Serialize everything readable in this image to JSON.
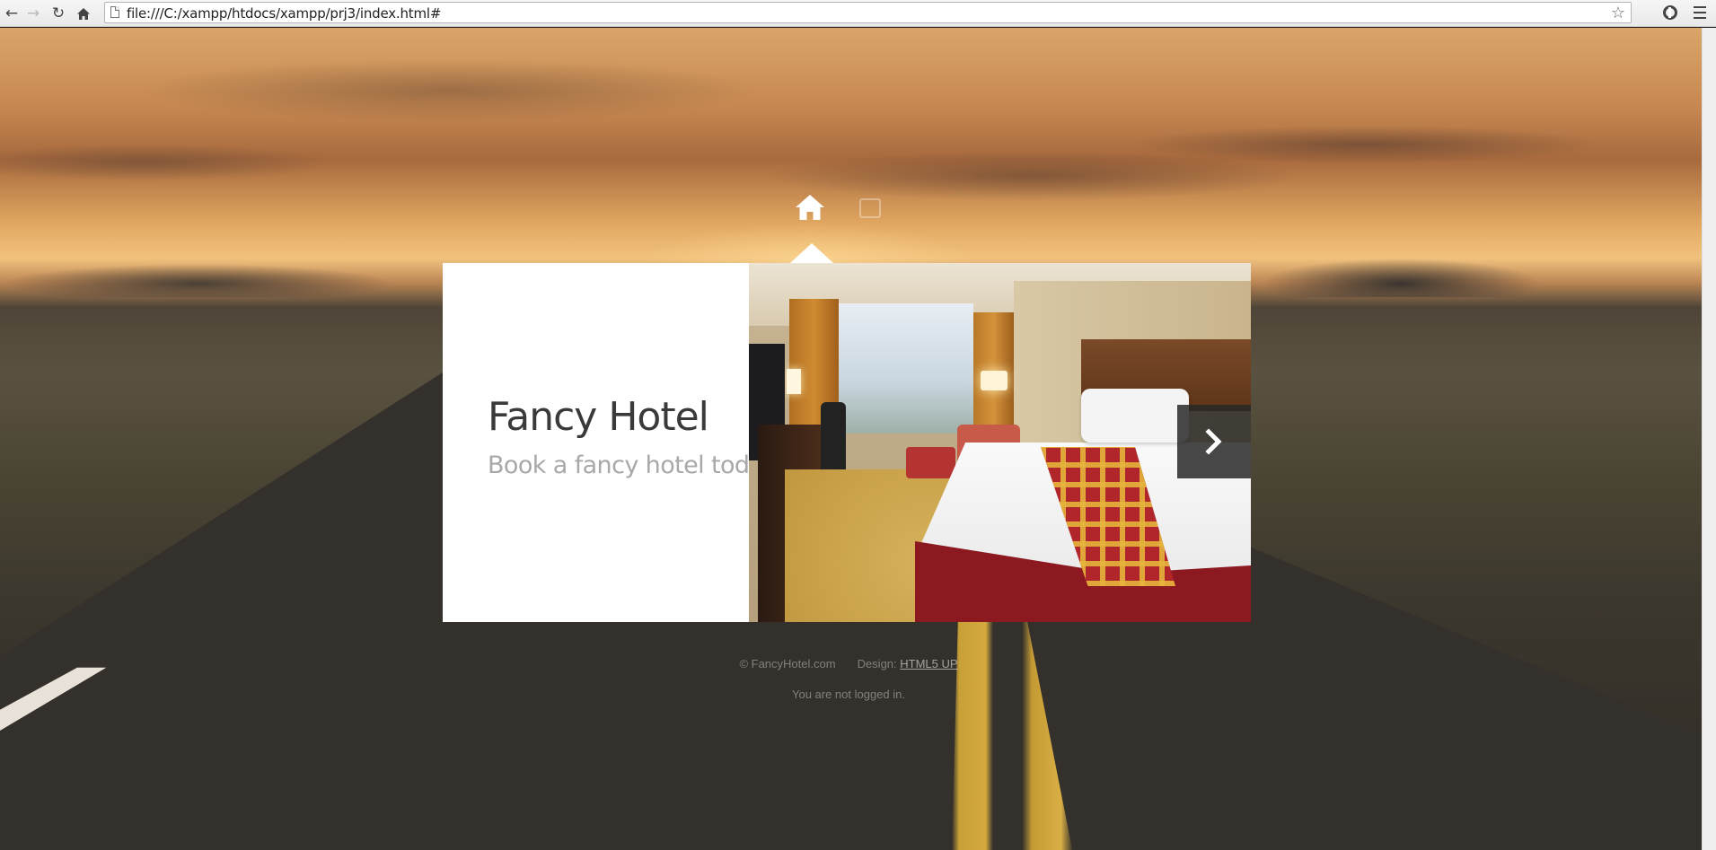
{
  "browser": {
    "url": "file:///C:/xampp/htdocs/xampp/prj3/index.html#",
    "back_icon": "arrow-left-icon",
    "forward_icon": "arrow-right-icon",
    "reload_icon": "reload-icon",
    "home_icon": "home-icon",
    "bookmark_icon": "star-icon",
    "menu_icon": "hamburger-menu-icon"
  },
  "nav": {
    "items": [
      {
        "icon": "home-icon",
        "active": true
      },
      {
        "icon": "profile-icon",
        "active": false
      }
    ]
  },
  "intro": {
    "title": "Fancy Hotel",
    "subtitle": "Book a fancy hotel today"
  },
  "footer": {
    "copyright": "© FancyHotel.com",
    "design_label": "Design:",
    "design_link": "HTML5 UP",
    "login_status": "You are not logged in."
  },
  "colors": {
    "panel_background": "#ffffff",
    "title_color": "#3a3a3a",
    "subtitle_color": "#a8a8a8",
    "next_button_background": "#282828"
  }
}
